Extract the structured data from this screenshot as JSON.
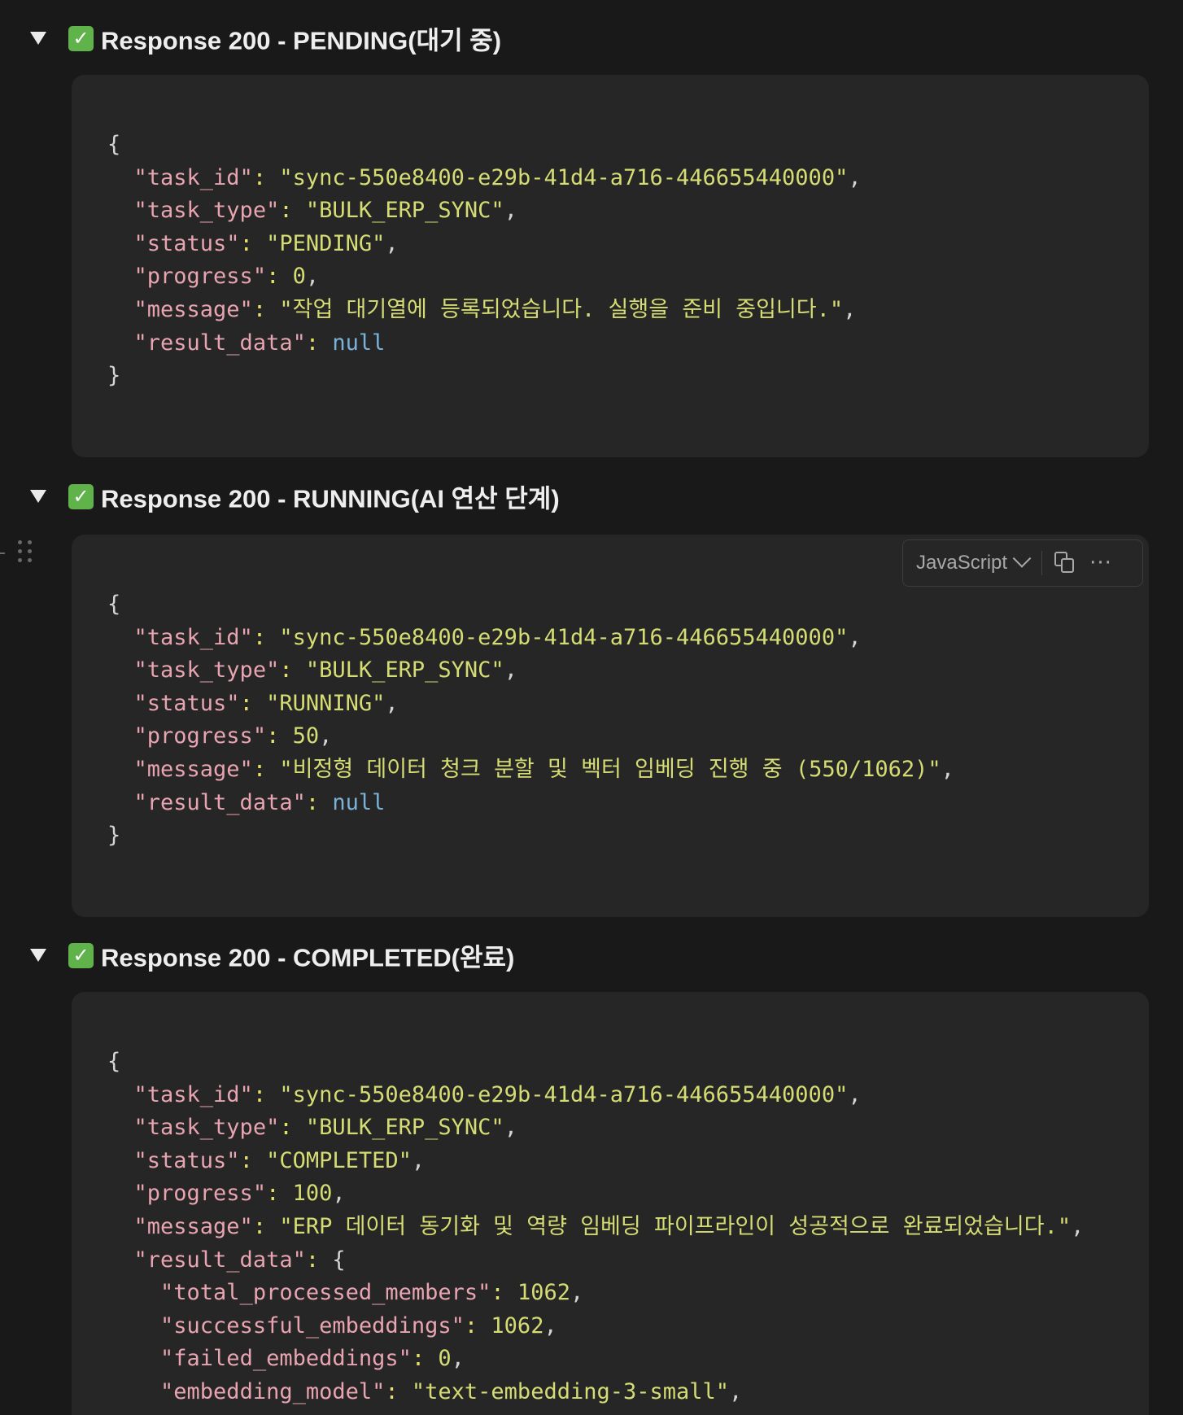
{
  "toggles": [
    {
      "title": "Response 200 - PENDING(대기 중)",
      "code": {
        "open": "{",
        "task_id_key": "\"task_id\"",
        "task_id_val": "\"sync-550e8400-e29b-41d4-a716-446655440000\"",
        "task_type_key": "\"task_type\"",
        "task_type_val": "\"BULK_ERP_SYNC\"",
        "status_key": "\"status\"",
        "status_val": "\"PENDING\"",
        "progress_key": "\"progress\"",
        "progress_val": "0",
        "message_key": "\"message\"",
        "message_val": "\"작업 대기열에 등록되었습니다. 실행을 준비 중입니다.\"",
        "result_key": "\"result_data\"",
        "result_val": "null",
        "close": "}"
      }
    },
    {
      "title": "Response 200 - RUNNING(AI 연산 단계)",
      "toolbar": {
        "language": "JavaScript",
        "more": "···"
      },
      "code": {
        "open": "{",
        "task_id_key": "\"task_id\"",
        "task_id_val": "\"sync-550e8400-e29b-41d4-a716-446655440000\"",
        "task_type_key": "\"task_type\"",
        "task_type_val": "\"BULK_ERP_SYNC\"",
        "status_key": "\"status\"",
        "status_val": "\"RUNNING\"",
        "progress_key": "\"progress\"",
        "progress_val": "50",
        "message_key": "\"message\"",
        "message_val": "\"비정형 데이터 청크 분할 및 벡터 임베딩 진행 중 (550/1062)\"",
        "result_key": "\"result_data\"",
        "result_val": "null",
        "close": "}"
      }
    },
    {
      "title": "Response 200 - COMPLETED(완료)",
      "code": {
        "open": "{",
        "task_id_key": "\"task_id\"",
        "task_id_val": "\"sync-550e8400-e29b-41d4-a716-446655440000\"",
        "task_type_key": "\"task_type\"",
        "task_type_val": "\"BULK_ERP_SYNC\"",
        "status_key": "\"status\"",
        "status_val": "\"COMPLETED\"",
        "progress_key": "\"progress\"",
        "progress_val": "100",
        "message_key": "\"message\"",
        "message_val": "\"ERP 데이터 동기화 및 역량 임베딩 파이프라인이 성공적으로 완료되었습니다.\"",
        "result_key": "\"result_data\"",
        "result_open": "{",
        "total_key": "\"total_processed_members\"",
        "total_val": "1062",
        "success_key": "\"successful_embeddings\"",
        "success_val": "1062",
        "failed_key": "\"failed_embeddings\"",
        "failed_val": "0",
        "model_key": "\"embedding_model\"",
        "model_val": "\"text-embedding-3-small\""
      }
    }
  ],
  "check_icon": "✓"
}
